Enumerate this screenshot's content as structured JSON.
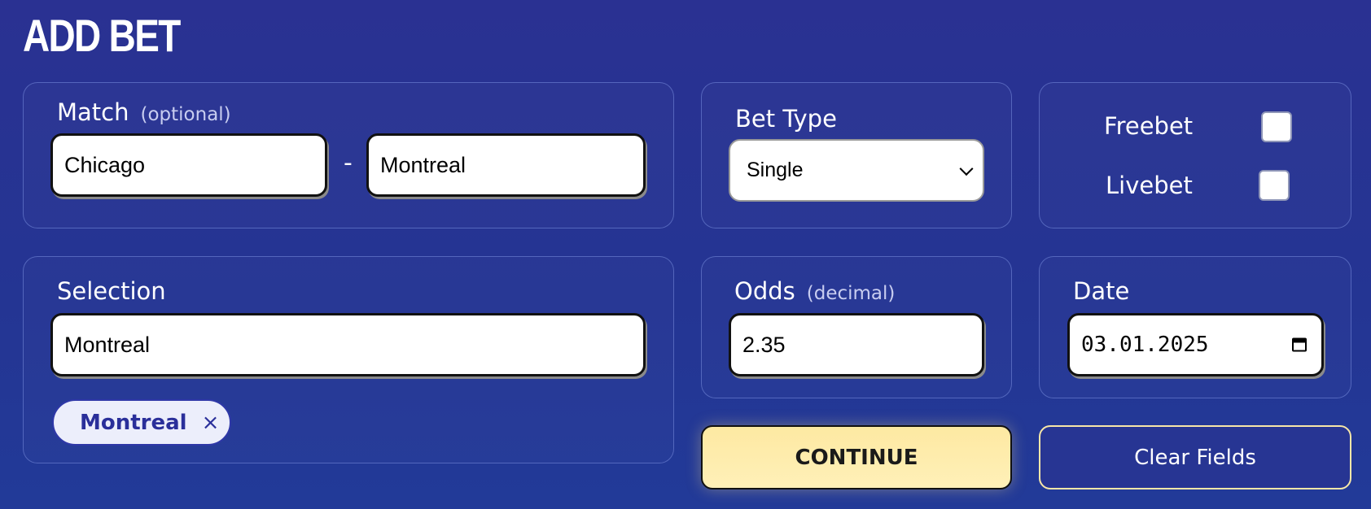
{
  "title": "ADD BET",
  "match": {
    "label": "Match",
    "hint": "(optional)",
    "home_value": "Chicago",
    "separator": "-",
    "away_value": "Montreal"
  },
  "bet_type": {
    "label": "Bet Type",
    "selected": "Single"
  },
  "flags": {
    "freebet_label": "Freebet",
    "freebet_checked": false,
    "livebet_label": "Livebet",
    "livebet_checked": false
  },
  "selection": {
    "label": "Selection",
    "value": "Montreal",
    "chip_label": "Montreal",
    "chip_remove": "×"
  },
  "odds": {
    "label": "Odds",
    "hint": "(decimal)",
    "value": "2.35"
  },
  "date": {
    "label": "Date",
    "value": "03.01.2025"
  },
  "actions": {
    "continue_label": "CONTINUE",
    "clear_label": "Clear Fields"
  },
  "colors": {
    "background": "#26348f",
    "accent_button": "#fdeaa6",
    "chip_text": "#2a2f9a"
  }
}
